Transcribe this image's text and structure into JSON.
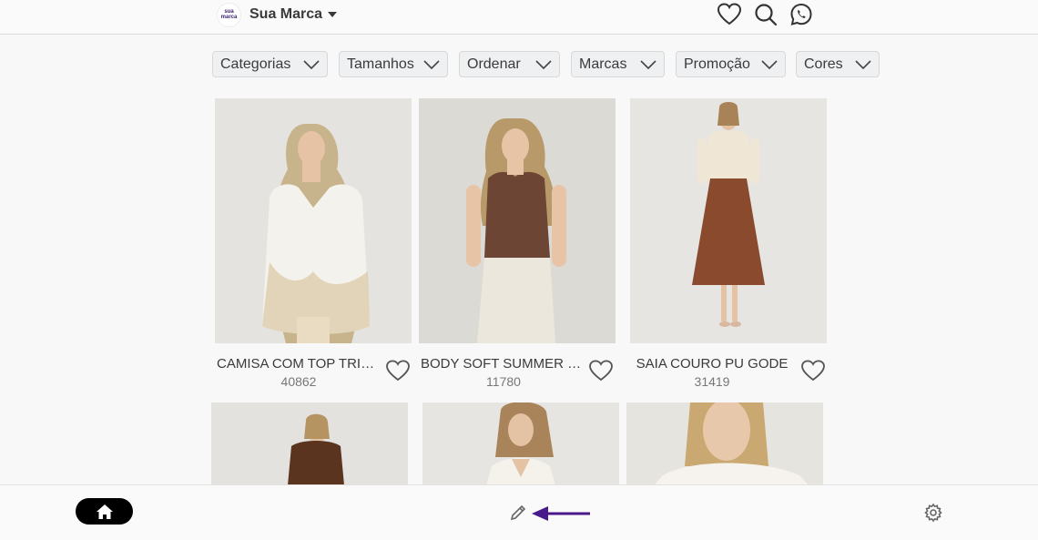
{
  "header": {
    "brand_logo_text": "sua marca",
    "brand_name": "Sua Marca"
  },
  "filters": [
    {
      "label": "Categorias"
    },
    {
      "label": "Tamanhos"
    },
    {
      "label": "Ordenar"
    },
    {
      "label": "Marcas"
    },
    {
      "label": "Promoção"
    },
    {
      "label": "Cores"
    }
  ],
  "products": [
    {
      "title": "CAMISA COM TOP TRICOT",
      "code": "40862",
      "favorited": false
    },
    {
      "title": "BODY SOFT SUMMER PREGAS",
      "code": "11780",
      "favorited": false
    },
    {
      "title": "SAIA COURO PU GODE",
      "code": "31419",
      "favorited": false
    }
  ],
  "colors": {
    "accent": "#4b1a8a",
    "topbar_bg": "#fafafa",
    "filter_bg": "#eef0f2",
    "home_button_bg": "#000000"
  },
  "icons": {
    "favorites": "heart-icon",
    "search": "search-icon",
    "whatsapp": "whatsapp-icon",
    "home": "home-icon",
    "edit": "pencil-icon",
    "settings": "gear-icon"
  }
}
